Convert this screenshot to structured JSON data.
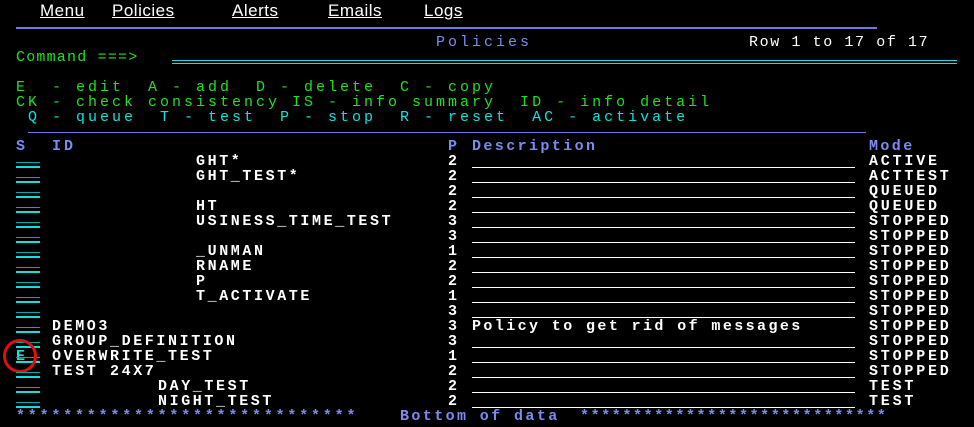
{
  "menu": [
    "Menu",
    "Policies",
    "Alerts",
    "Emails",
    "Logs"
  ],
  "title": "Policies",
  "row_info": "Row 1 to 17 of 17",
  "command_label": "Command ===>",
  "command_value": "",
  "help_lines": [
    "E  - edit  A - add  D - delete  C - copy",
    "CK - check consistency IS - info summary  ID - info detail",
    " Q - queue  T - test  P - stop  R - reset  AC - activate"
  ],
  "columns": {
    "s": "S",
    "id": "ID",
    "p": "P",
    "description": "Description",
    "mode": "Mode"
  },
  "rows": [
    {
      "s": "",
      "id": "GHT*",
      "p": "2",
      "description": "",
      "mode": "ACTIVE"
    },
    {
      "s": "",
      "id": "GHT_TEST*",
      "p": "2",
      "description": "",
      "mode": "ACTTEST"
    },
    {
      "s": "",
      "id": "",
      "p": "2",
      "description": "",
      "mode": "QUEUED"
    },
    {
      "s": "",
      "id": "HT",
      "p": "2",
      "description": "",
      "mode": "QUEUED"
    },
    {
      "s": "",
      "id": "USINESS_TIME_TEST",
      "p": "3",
      "description": "",
      "mode": "STOPPED"
    },
    {
      "s": "",
      "id": "",
      "p": "3",
      "description": "",
      "mode": "STOPPED"
    },
    {
      "s": "",
      "id": "_UNMAN",
      "p": "1",
      "description": "",
      "mode": "STOPPED"
    },
    {
      "s": "",
      "id": "RNAME",
      "p": "2",
      "description": "",
      "mode": "STOPPED"
    },
    {
      "s": "",
      "id": "P",
      "p": "2",
      "description": "",
      "mode": "STOPPED"
    },
    {
      "s": "",
      "id": "T_ACTIVATE",
      "p": "1",
      "description": "",
      "mode": "STOPPED"
    },
    {
      "s": "",
      "id": "",
      "p": "3",
      "description": "",
      "mode": "STOPPED"
    },
    {
      "s": "",
      "id": "DEMO3",
      "p": "3",
      "description": "Policy to get rid of messages",
      "mode": "STOPPED"
    },
    {
      "s": "",
      "id": "GROUP_DEFINITION",
      "p": "3",
      "description": "",
      "mode": "STOPPED"
    },
    {
      "s": "E",
      "id": "OVERWRITE_TEST",
      "p": "1",
      "description": "",
      "mode": "STOPPED",
      "highlighted": true
    },
    {
      "s": "",
      "id": "TEST 24X7",
      "p": "2",
      "description": "",
      "mode": "STOPPED"
    },
    {
      "s": "",
      "id": "DAY_TEST",
      "p": "2",
      "description": "",
      "mode": "TEST"
    },
    {
      "s": "",
      "id": "NIGHT_TEST",
      "p": "2",
      "description": "",
      "mode": "TEST"
    }
  ],
  "bottom_left": "*****************************",
  "bottom_text": "Bottom of data",
  "bottom_right": "*****************************",
  "colors": {
    "blue": "#7b8bf0",
    "green": "#20e020",
    "cyan": "#10e0e0",
    "highlight": "#e01010"
  }
}
